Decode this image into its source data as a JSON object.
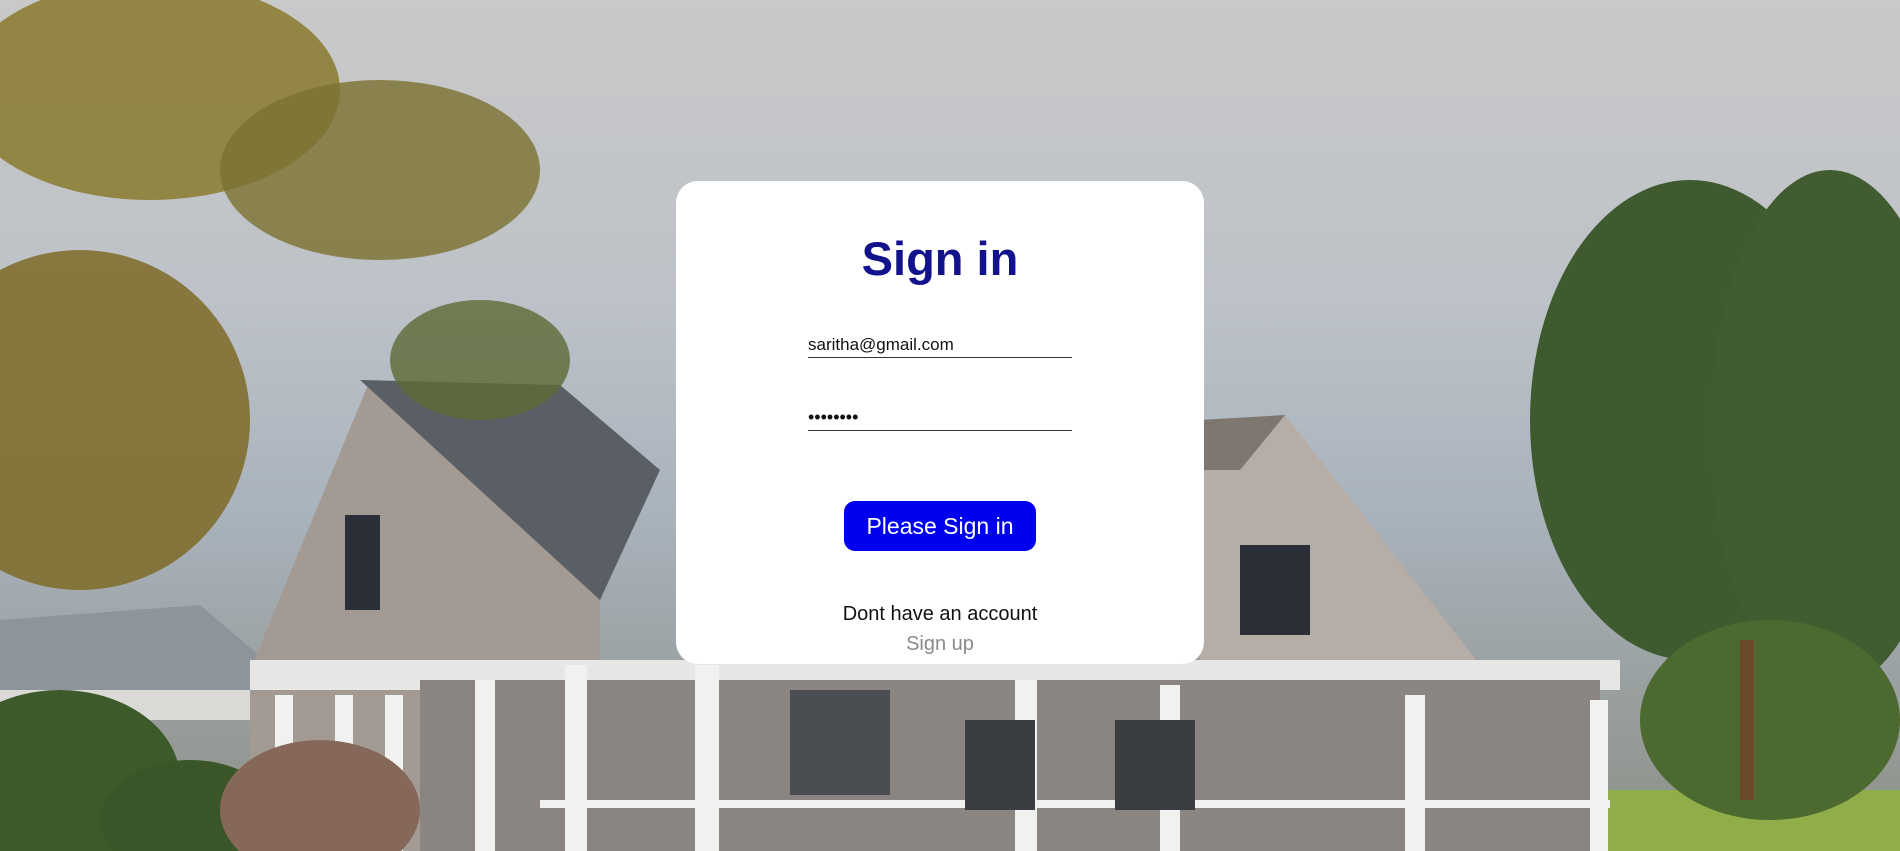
{
  "form": {
    "title": "Sign in",
    "email_value": "saritha@gmail.com",
    "password_value": "aaaaaaaa",
    "submit_label": "Please Sign in",
    "no_account_text": "Dont have an account",
    "signup_link": "Sign up"
  },
  "colors": {
    "title": "#12128c",
    "button": "#0000f0",
    "signup_link": "#8a8a8a"
  }
}
